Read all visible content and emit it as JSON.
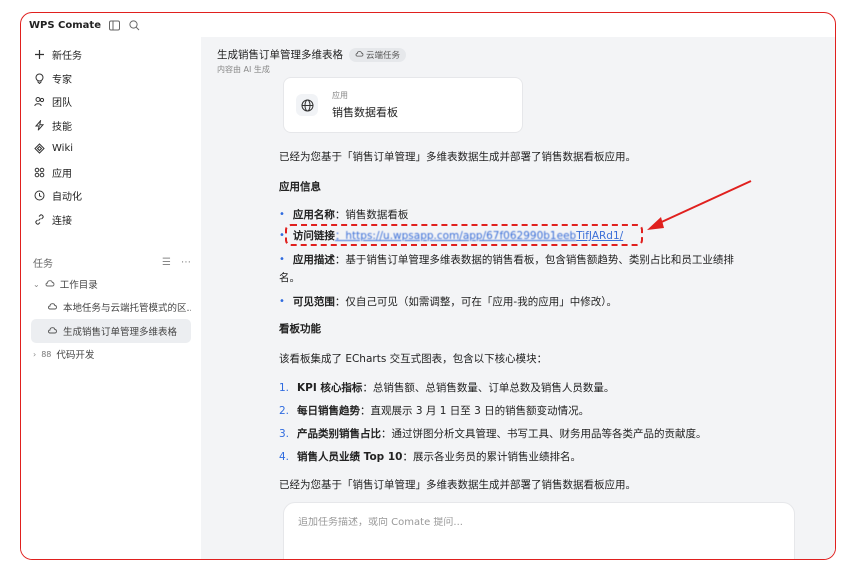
{
  "app": {
    "title": "WPS Comate"
  },
  "sidebar": {
    "nav": [
      {
        "icon": "plus-icon",
        "label": "新任务"
      },
      {
        "icon": "expert-icon",
        "label": "专家"
      },
      {
        "icon": "team-icon",
        "label": "团队"
      },
      {
        "icon": "skill-icon",
        "label": "技能"
      },
      {
        "icon": "wiki-icon",
        "label": "Wiki"
      },
      {
        "icon": "apps-icon",
        "label": "应用"
      },
      {
        "icon": "clock-icon",
        "label": "自动化"
      },
      {
        "icon": "link-icon",
        "label": "连接"
      }
    ],
    "tasks_label": "任务",
    "tree": {
      "folder": "工作目录",
      "children": [
        "本地任务与云端托管模式的区...",
        "生成销售订单管理多维表格"
      ],
      "collapsed": "代码开发"
    }
  },
  "task": {
    "title": "生成销售订单管理多维表格",
    "badge": "云端任务",
    "subtitle": "内容由 AI 生成"
  },
  "app_card": {
    "label": "应用",
    "name": "销售数据看板"
  },
  "content": {
    "intro": "已经为您基于「销售订单管理」多维表数据生成并部署了销售数据看板应用。",
    "info_heading": "应用信息",
    "info": [
      {
        "key": "应用名称",
        "value": "：销售数据看板"
      },
      {
        "key": "访问链接",
        "value": "：https://u.wpsapp.com/app/67f062990b1eeb",
        "tail": "TifJARd1/"
      },
      {
        "key": "应用描述",
        "value": "：基于销售订单管理多维表数据的销售看板，包含销售额趋势、类别占比和员工业绩排",
        "wrap": "名。"
      },
      {
        "key": "可见范围",
        "value": "：仅自己可见（如需调整，可在「应用-我的应用」中修改）。"
      }
    ],
    "feature_heading": "看板功能",
    "feature_intro": "该看板集成了 ECharts 交互式图表，包含以下核心模块：",
    "features": [
      {
        "num": "1.",
        "key": "KPI 核心指标",
        "value": "：总销售额、总销售数量、订单总数及销售人员数量。"
      },
      {
        "num": "2.",
        "key": "每日销售趋势",
        "value": "：直观展示 3 月 1 日至 3 日的销售额变动情况。"
      },
      {
        "num": "3.",
        "key": "产品类别销售占比",
        "value": "：通过饼图分析文具管理、书写工具、财务用品等各类产品的贡献度。"
      },
      {
        "num": "4.",
        "key": "销售人员业绩 Top 10",
        "value": "：展示各业务员的累计销售业绩排名。"
      }
    ],
    "outro": "已经为您基于「销售订单管理」多维表数据生成并部署了销售数据看板应用。"
  },
  "input": {
    "placeholder": "追加任务描述，或向 Comate 提问..."
  },
  "colors": {
    "annotation": "#e0201e",
    "link": "#3b6fd8",
    "accent": "#2f6bdf"
  }
}
